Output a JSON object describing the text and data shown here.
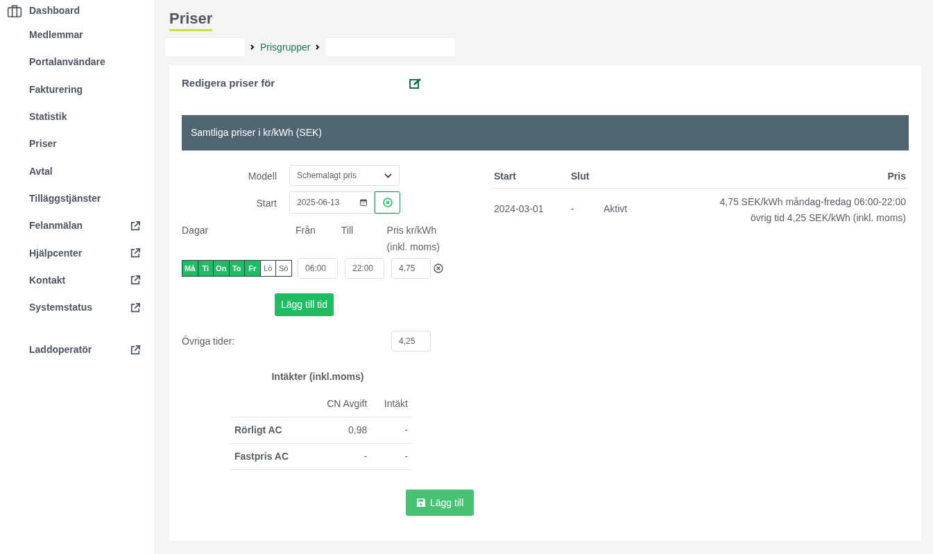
{
  "sidebar": {
    "items": [
      {
        "label": "Dashboard",
        "kind": "section",
        "external": false
      },
      {
        "label": "Medlemmar",
        "kind": "link",
        "external": false
      },
      {
        "label": "Portalanvändare",
        "kind": "link",
        "external": false
      },
      {
        "label": "Fakturering",
        "kind": "link",
        "external": false
      },
      {
        "label": "Statistik",
        "kind": "link",
        "external": false
      },
      {
        "label": "Priser",
        "kind": "link",
        "external": false
      },
      {
        "label": "Avtal",
        "kind": "link",
        "external": false
      },
      {
        "label": "Tilläggstjänster",
        "kind": "link",
        "external": false
      },
      {
        "label": "Felanmälan",
        "kind": "link",
        "external": true
      },
      {
        "label": "Hjälpcenter",
        "kind": "link",
        "external": true
      },
      {
        "label": "Kontakt",
        "kind": "link",
        "external": true
      },
      {
        "label": "Systemstatus",
        "kind": "link",
        "external": true
      },
      {
        "label": "Laddoperatör",
        "kind": "spaced",
        "external": true
      }
    ]
  },
  "page_title": "Priser",
  "breadcrumb": [
    "Prisgrupper"
  ],
  "card": {
    "heading": "Redigera priser för",
    "banner": "Samtliga priser i kr/kWh (SEK)",
    "form": {
      "model_label": "Modell",
      "model_value": "Schemalagt pris",
      "start_label": "Start",
      "start_value": "2025-06-13",
      "columns": [
        "Dagar",
        "Från",
        "Till",
        "Pris kr/kWh (inkl. moms)"
      ],
      "days": [
        {
          "label": "Må",
          "selected": true
        },
        {
          "label": "Ti",
          "selected": true
        },
        {
          "label": "On",
          "selected": true
        },
        {
          "label": "To",
          "selected": true
        },
        {
          "label": "Fr",
          "selected": true
        },
        {
          "label": "Lö",
          "selected": false
        },
        {
          "label": "Sö",
          "selected": false
        }
      ],
      "from": "06:00",
      "to": "22:00",
      "price": "4,75",
      "add_time_button": "Lägg till tid",
      "other_label": "Övriga tider:",
      "other_value": "4,25"
    },
    "revenue": {
      "title": "Intäkter (inkl.moms)",
      "columns": [
        "CN Avgift",
        "Intäkt"
      ],
      "rows": [
        {
          "label": "Rörligt AC",
          "values": [
            "0,98",
            "-"
          ]
        },
        {
          "label": "Fastpris AC",
          "values": [
            "-",
            "-"
          ]
        }
      ]
    },
    "save_button": "Lägg till",
    "history": {
      "columns": [
        "Start",
        "Slut",
        "",
        "Pris"
      ],
      "rows": [
        {
          "start": "2024-03-01",
          "end": "-",
          "status": "Aktivt",
          "price_lines": [
            "4,75 SEK/kWh måndag-fredag 06:00-22:00",
            "övrig tid 4,25 SEK/kWh (inkl. moms)"
          ]
        }
      ]
    }
  }
}
